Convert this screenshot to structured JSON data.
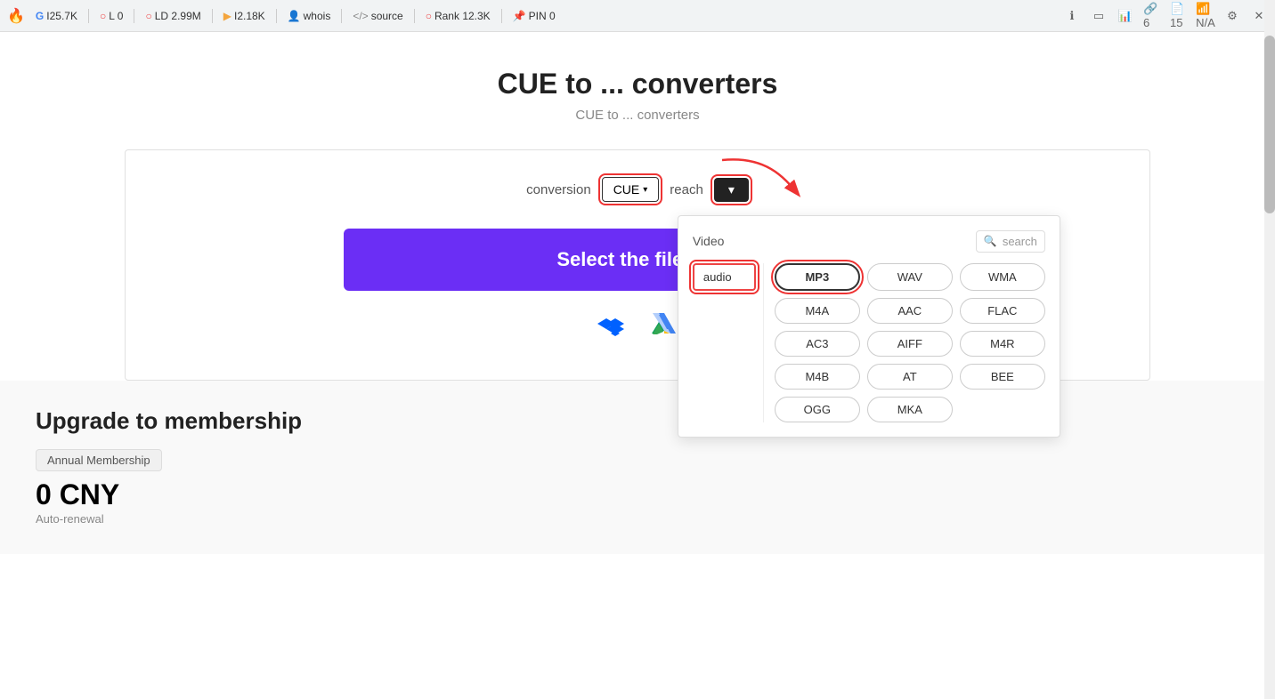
{
  "browser": {
    "toolbar": {
      "stats": [
        {
          "icon": "flame",
          "label": "I25.7K"
        },
        {
          "icon": "circle-l",
          "label": "L 0"
        },
        {
          "icon": "circle-ld",
          "label": "LD 2.99M"
        },
        {
          "icon": "circle-b",
          "label": "I2.18K"
        },
        {
          "icon": "person",
          "label": "whois"
        },
        {
          "icon": "code",
          "label": "source"
        },
        {
          "icon": "circle-r",
          "label": "Rank 12.3K"
        },
        {
          "icon": "pin",
          "label": "PIN 0"
        }
      ],
      "right_icons": [
        "info",
        "tablet",
        "chart",
        "links-6",
        "pages-15",
        "wifi-na",
        "gear",
        "close"
      ]
    }
  },
  "page": {
    "title": "CUE to ... converters",
    "subtitle": "CUE to ... converters"
  },
  "converter": {
    "conversion_label": "conversion",
    "from_format": "CUE",
    "reach_label": "reach",
    "target_placeholder": "▾",
    "select_file_label": "Select the file",
    "file_icon": "📁"
  },
  "dropdown": {
    "video_label": "Video",
    "search_placeholder": "search",
    "categories": [
      {
        "id": "audio",
        "label": "audio",
        "active": true
      }
    ],
    "formats": [
      {
        "label": "MP3",
        "selected": true
      },
      {
        "label": "WAV",
        "selected": false
      },
      {
        "label": "WMA",
        "selected": false
      },
      {
        "label": "M4A",
        "selected": false
      },
      {
        "label": "AAC",
        "selected": false
      },
      {
        "label": "FLAC",
        "selected": false
      },
      {
        "label": "AC3",
        "selected": false
      },
      {
        "label": "AIFF",
        "selected": false
      },
      {
        "label": "M4R",
        "selected": false
      },
      {
        "label": "M4B",
        "selected": false
      },
      {
        "label": "AT",
        "selected": false
      },
      {
        "label": "BEE",
        "selected": false
      },
      {
        "label": "OGG",
        "selected": false
      },
      {
        "label": "MKA",
        "selected": false
      }
    ]
  },
  "upgrade": {
    "title": "Upgrade to membership",
    "badge": "Annual Membership",
    "price": "0 CNY",
    "renewal": "Auto-renewal"
  }
}
